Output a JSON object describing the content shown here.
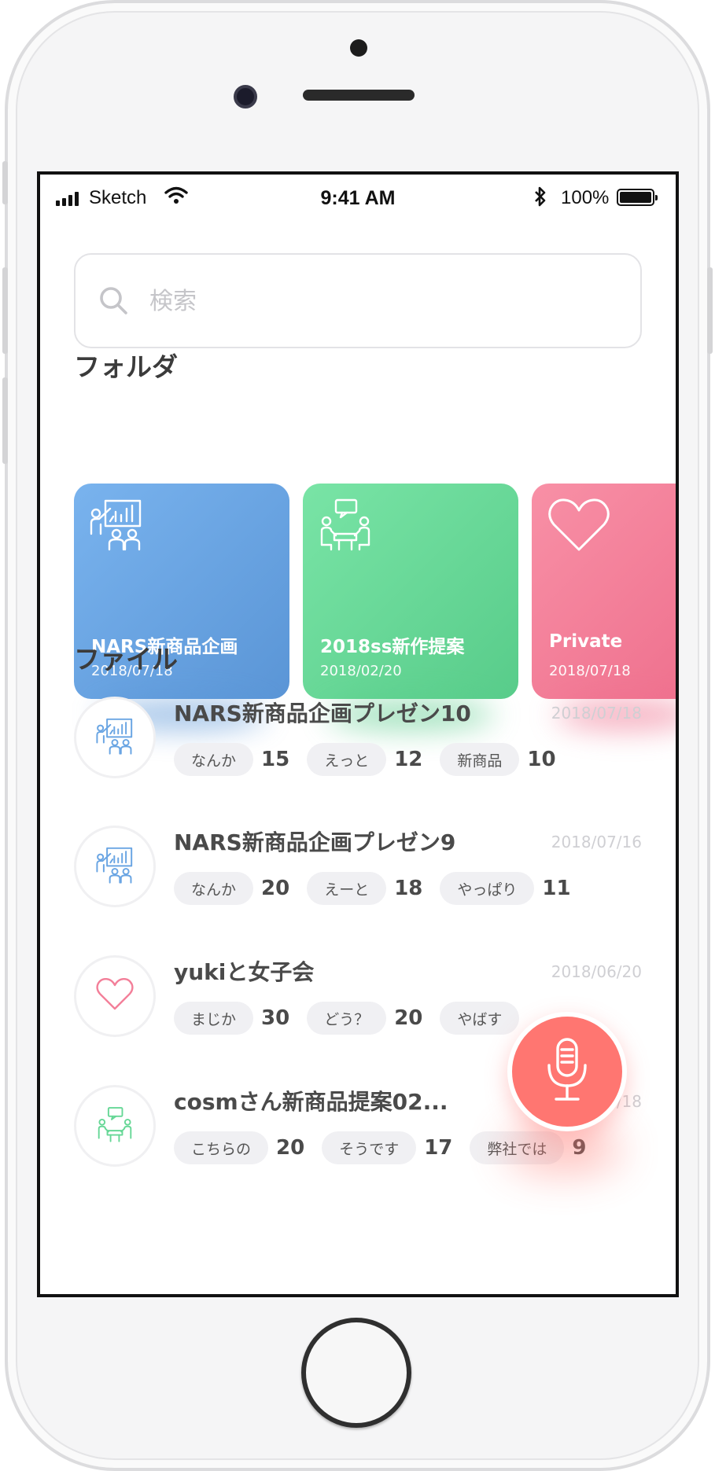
{
  "status_bar": {
    "carrier": "Sketch",
    "time": "9:41 AM",
    "battery": "100%",
    "signal_icon": "signal-bars-icon",
    "wifi_icon": "wifi-icon",
    "bluetooth_icon": "bluetooth-icon"
  },
  "search": {
    "placeholder": "検索",
    "icon": "search-icon"
  },
  "folders_section": {
    "title": "フォルダ",
    "folders": [
      {
        "name": "NARS新商品企画",
        "date": "2018/07/18",
        "icon": "presentation-icon",
        "color": "#6aa5e3"
      },
      {
        "name": "2018ss新作提案",
        "date": "2018/02/20",
        "icon": "meeting-icon",
        "color": "#66d796"
      },
      {
        "name": "Private",
        "date": "2018/07/18",
        "icon": "heart-icon",
        "color": "#f37f99"
      }
    ]
  },
  "files_section": {
    "title": "ファイル",
    "files": [
      {
        "title": "NARS新商品企画プレゼン10",
        "date": "2018/07/18",
        "icon": "presentation-icon",
        "tags": [
          {
            "label": "なんか",
            "count": "15"
          },
          {
            "label": "えっと",
            "count": "12"
          },
          {
            "label": "新商品",
            "count": "10"
          }
        ]
      },
      {
        "title": "NARS新商品企画プレゼン9",
        "date": "2018/07/16",
        "icon": "presentation-icon",
        "tags": [
          {
            "label": "なんか",
            "count": "20"
          },
          {
            "label": "えーと",
            "count": "18"
          },
          {
            "label": "やっぱり",
            "count": "11"
          }
        ]
      },
      {
        "title": "yukiと女子会",
        "date": "2018/06/20",
        "icon": "heart-icon",
        "tags": [
          {
            "label": "まじか",
            "count": "30"
          },
          {
            "label": "どう？",
            "count": "20"
          },
          {
            "label": "やばす",
            "count": ""
          }
        ]
      },
      {
        "title": "cosmさん新商品提案02...",
        "date": "/18",
        "icon": "meeting-icon",
        "tags": [
          {
            "label": "こちらの",
            "count": "20"
          },
          {
            "label": "そうです",
            "count": "17"
          },
          {
            "label": "弊社では",
            "count": "9"
          }
        ]
      }
    ]
  },
  "mic_button": {
    "icon": "microphone-icon",
    "color": "#ff7671"
  }
}
